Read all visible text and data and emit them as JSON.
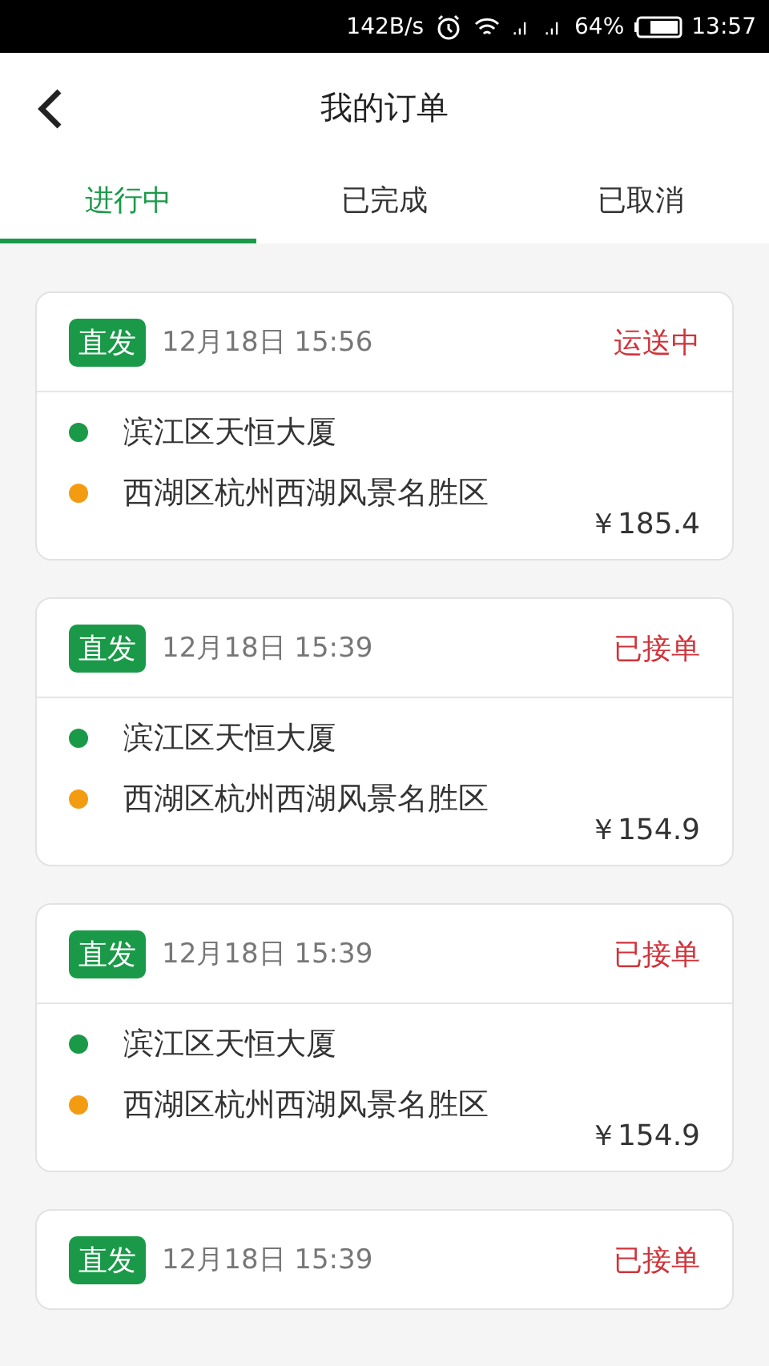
{
  "status_bar": {
    "speed": "142B/s",
    "battery": "64%",
    "time": "13:57"
  },
  "header": {
    "title": "我的订单"
  },
  "tabs": [
    {
      "label": "进行中",
      "selected": true
    },
    {
      "label": "已完成",
      "selected": false
    },
    {
      "label": "已取消",
      "selected": false
    }
  ],
  "orders": [
    {
      "tag": "直发",
      "time": "12月18日 15:56",
      "status": "运送中",
      "price": "￥185.4",
      "stops": [
        {
          "address": "滨江区天恒大厦",
          "color": "#1a9a48"
        },
        {
          "address": "西湖区杭州西湖风景名胜区",
          "color": "#f39c12"
        }
      ]
    },
    {
      "tag": "直发",
      "time": "12月18日 15:39",
      "status": "已接单",
      "price": "￥154.9",
      "stops": [
        {
          "address": "滨江区天恒大厦",
          "color": "#1a9a48"
        },
        {
          "address": "西湖区杭州西湖风景名胜区",
          "color": "#f39c12"
        }
      ]
    },
    {
      "tag": "直发",
      "time": "12月18日 15:39",
      "status": "已接单",
      "price": "￥154.9",
      "stops": [
        {
          "address": "滨江区天恒大厦",
          "color": "#1a9a48"
        },
        {
          "address": "西湖区杭州西湖风景名胜区",
          "color": "#f39c12"
        }
      ]
    },
    {
      "tag": "直发",
      "time": "12月18日 15:39",
      "status": "已接单"
    }
  ]
}
